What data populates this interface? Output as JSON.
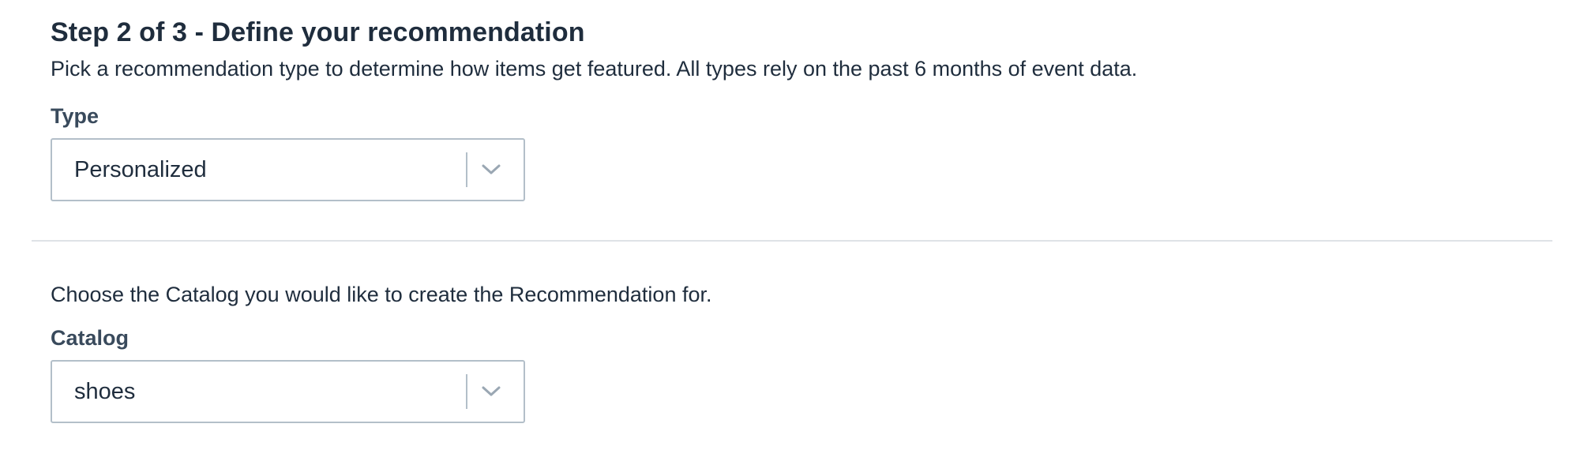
{
  "step": {
    "title": "Step 2 of 3 - Define your recommendation",
    "description": "Pick a recommendation type to determine how items get featured. All types rely on the past 6 months of event data."
  },
  "type_field": {
    "label": "Type",
    "value": "Personalized",
    "icon": "chevron-down-icon"
  },
  "catalog_section": {
    "description": "Choose the Catalog you would like to create the Recommendation for."
  },
  "catalog_field": {
    "label": "Catalog",
    "value": "shoes",
    "icon": "chevron-down-icon"
  },
  "colors": {
    "text": "#1f2d3d",
    "label": "#394a5c",
    "border": "#b3bfc9",
    "divider": "#dfe3e7",
    "chevron": "#9aa7b3"
  }
}
